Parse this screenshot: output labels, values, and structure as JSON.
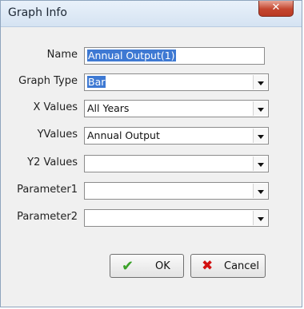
{
  "window": {
    "title": "Graph Info",
    "close_glyph": "✕"
  },
  "form": {
    "name": {
      "label": "Name",
      "value": "Annual Output(1)"
    },
    "graph_type": {
      "label": "Graph Type",
      "value": "Bar"
    },
    "x_values": {
      "label": "X Values",
      "value": "All Years"
    },
    "y_values": {
      "label": "YValues",
      "value": "Annual Output"
    },
    "y2_values": {
      "label": "Y2 Values",
      "value": ""
    },
    "parameter1": {
      "label": "Parameter1",
      "value": ""
    },
    "parameter2": {
      "label": "Parameter2",
      "value": ""
    }
  },
  "buttons": {
    "ok": {
      "label": "OK",
      "icon": "checkmark-icon",
      "glyph": "✔",
      "color": "#3aa128"
    },
    "cancel": {
      "label": "Cancel",
      "icon": "x-icon",
      "glyph": "✖",
      "color": "#d21010"
    }
  }
}
